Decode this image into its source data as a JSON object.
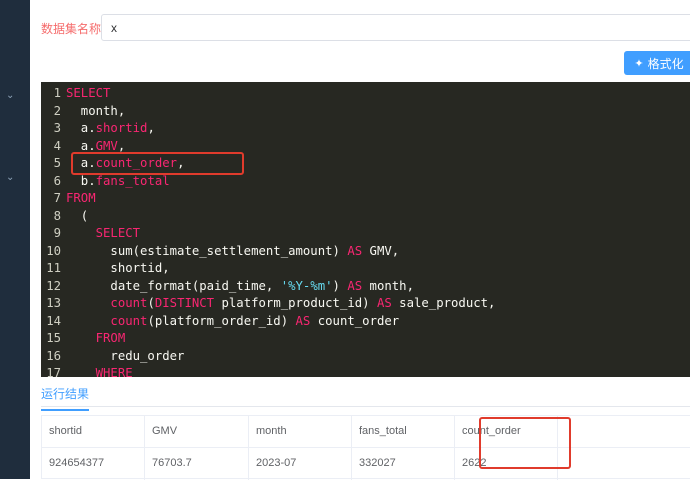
{
  "form": {
    "dataset_label": "数据集名称:",
    "dataset_value": "x"
  },
  "toolbar": {
    "format_label": "格式化",
    "format_icon": "magic-wand-icon"
  },
  "editor": {
    "lines": [
      {
        "n": "1",
        "tokens": [
          {
            "t": "SELECT",
            "c": "kw"
          }
        ]
      },
      {
        "n": "2",
        "tokens": [
          {
            "t": "  month,",
            "c": ""
          }
        ]
      },
      {
        "n": "3",
        "tokens": [
          {
            "t": "  a.",
            "c": ""
          },
          {
            "t": "shortid",
            "c": "id"
          },
          {
            "t": ",",
            "c": ""
          }
        ]
      },
      {
        "n": "4",
        "tokens": [
          {
            "t": "  a.",
            "c": ""
          },
          {
            "t": "GMV",
            "c": "id"
          },
          {
            "t": ",",
            "c": ""
          }
        ]
      },
      {
        "n": "5",
        "tokens": [
          {
            "t": "  a.",
            "c": ""
          },
          {
            "t": "count_order",
            "c": "id"
          },
          {
            "t": ",",
            "c": ""
          }
        ]
      },
      {
        "n": "6",
        "tokens": [
          {
            "t": "  b.",
            "c": ""
          },
          {
            "t": "fans_total",
            "c": "id"
          }
        ]
      },
      {
        "n": "7",
        "tokens": [
          {
            "t": "FROM",
            "c": "kw"
          }
        ]
      },
      {
        "n": "8",
        "tokens": [
          {
            "t": "  (",
            "c": ""
          }
        ]
      },
      {
        "n": "9",
        "tokens": [
          {
            "t": "    ",
            "c": ""
          },
          {
            "t": "SELECT",
            "c": "kw"
          }
        ]
      },
      {
        "n": "10",
        "tokens": [
          {
            "t": "      sum(estimate_settlement_amount) ",
            "c": ""
          },
          {
            "t": "AS",
            "c": "kw"
          },
          {
            "t": " GMV,",
            "c": ""
          }
        ]
      },
      {
        "n": "11",
        "tokens": [
          {
            "t": "      shortid,",
            "c": ""
          }
        ]
      },
      {
        "n": "12",
        "tokens": [
          {
            "t": "      date_format(paid_time, ",
            "c": ""
          },
          {
            "t": "'%Y-%m'",
            "c": "str"
          },
          {
            "t": ") ",
            "c": ""
          },
          {
            "t": "AS",
            "c": "kw"
          },
          {
            "t": " month,",
            "c": ""
          }
        ]
      },
      {
        "n": "13",
        "tokens": [
          {
            "t": "      ",
            "c": ""
          },
          {
            "t": "count",
            "c": "fn"
          },
          {
            "t": "(",
            "c": ""
          },
          {
            "t": "DISTINCT",
            "c": "kw"
          },
          {
            "t": " platform_product_id) ",
            "c": ""
          },
          {
            "t": "AS",
            "c": "kw"
          },
          {
            "t": " sale_product,",
            "c": ""
          }
        ]
      },
      {
        "n": "14",
        "tokens": [
          {
            "t": "      ",
            "c": ""
          },
          {
            "t": "count",
            "c": "fn"
          },
          {
            "t": "(platform_order_id) ",
            "c": ""
          },
          {
            "t": "AS",
            "c": "kw"
          },
          {
            "t": " count_order",
            "c": ""
          }
        ]
      },
      {
        "n": "15",
        "tokens": [
          {
            "t": "    ",
            "c": ""
          },
          {
            "t": "FROM",
            "c": "kw"
          }
        ]
      },
      {
        "n": "16",
        "tokens": [
          {
            "t": "      redu_order",
            "c": ""
          }
        ]
      },
      {
        "n": "17",
        "tokens": [
          {
            "t": "    ",
            "c": ""
          },
          {
            "t": "WHERE",
            "c": "kw"
          }
        ]
      }
    ]
  },
  "results": {
    "tab_label": "运行结果",
    "columns": [
      "shortid",
      "GMV",
      "month",
      "fans_total",
      "count_order"
    ],
    "rows": [
      [
        "924654377",
        "76703.7",
        "2023-07",
        "332027",
        "2622"
      ]
    ]
  },
  "colors": {
    "accent": "#409eff",
    "highlight_border": "#e03b2c",
    "editor_bg": "#272822",
    "keyword": "#f92672"
  }
}
